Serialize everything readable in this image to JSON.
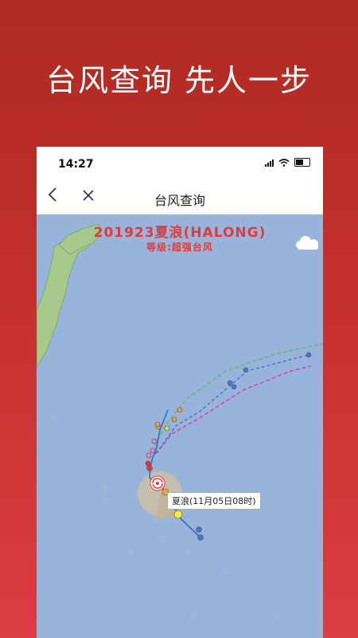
{
  "promo": {
    "headline": "台风查询 先人一步"
  },
  "status_bar": {
    "time": "14:27"
  },
  "nav": {
    "title": "台风查询"
  },
  "typhoon": {
    "title": "201923夏浪(HALONG)",
    "level": "等级:超强台风",
    "tooltip": "夏浪(11月05日08时)"
  },
  "colors": {
    "background_top": "#ad2a22",
    "background_bottom": "#dc3c44",
    "ocean": "#99b4da",
    "land": "#a8c98c",
    "title_red": "#e23a3a",
    "forecast_green": "#5fb877",
    "forecast_magenta": "#d43fb5",
    "track_blue": "#2f6cc0"
  },
  "icons": [
    "back-chevron-icon",
    "close-icon",
    "cloud-icon",
    "typhoon-icon",
    "wifi-icon",
    "signal-icon",
    "battery-icon"
  ]
}
